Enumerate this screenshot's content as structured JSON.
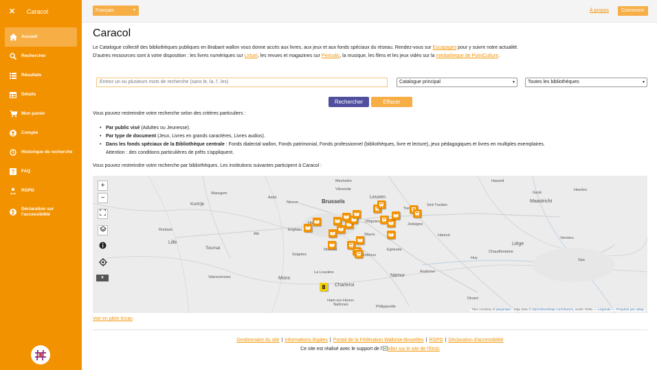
{
  "sidebar": {
    "title": "Caracol",
    "close_icon": "✕",
    "items": [
      {
        "label": "Accueil",
        "icon": "home-icon"
      },
      {
        "label": "Rechercher",
        "icon": "search-icon"
      },
      {
        "label": "Résultats",
        "icon": "list-icon"
      },
      {
        "label": "Détails",
        "icon": "details-icon"
      },
      {
        "label": "Mon panier",
        "icon": "cart-icon"
      },
      {
        "label": "Compte",
        "icon": "account-icon"
      },
      {
        "label": "Historique de recherche",
        "icon": "history-icon"
      },
      {
        "label": "FAQ",
        "icon": "faq-icon"
      },
      {
        "label": "RGPD",
        "icon": "rgpd-icon"
      },
      {
        "label": "Déclaration sur l'accessibilité",
        "icon": "accessibility-icon"
      }
    ],
    "active_index": 0
  },
  "topbar": {
    "language": "Français",
    "apropos": "À propos",
    "connexion": "Connexion"
  },
  "main": {
    "title": "Caracol",
    "intro": {
      "line1_a": "Le Catalogue collectif des bibliothèques publiques en Brabant wallon vous donne accès aux livres, aux jeux et aux fonds spéciaux du réseau. Rendez-vous sur ",
      "escapages": "Escapages",
      "line1_b": " pour y suivre notre actualité.",
      "line2_a": "D'autres ressources sont à votre disposition : les livres numériques sur ",
      "lirtuel": "Lirtuel",
      "line2_b": ", les revues et magazines sur ",
      "pericolic": "Pericolic",
      "line2_c": ", la musique, les films et les jeux vidéo sur la ",
      "pointculture": "médiathèque de PointCulture",
      "line2_d": "."
    },
    "search": {
      "placeholder": "Entrez un ou plusieurs mots de recherche (sans le, la, l', les)",
      "catalogue": "Catalogue principal",
      "libraries": "Toutes les bibliothèques",
      "search_button": "Rechercher",
      "clear_button": "Effacer"
    },
    "restrict_criteria": "Vous pouvez restreindre votre recherche selon des critères particuliers :",
    "criteria": [
      {
        "bold": "Par public visé",
        "text": " (Adultes ou Jeunesse)."
      },
      {
        "bold": "Par type de document",
        "text": " (Jeux, Livres en grands caractères, Livres audios)."
      },
      {
        "bold": "Dans les fonds spéciaux de la Bibliothèque centrale",
        "text": " : Fonds dialectal wallon, Fonds patrimonial, Fonds professionnel (bibliothèques, livre et lecture), jeux pédagogiques et livres en multiples exemplaires."
      }
    ],
    "criteria_note": "Attention : des conditions particulières de prêts s'appliquent.",
    "restrict_libraries": "Vous pouvez restreindre votre recherche par bibliothèques. Les institutions suivantes participent à Caracol :",
    "fullscreen_link": "Voir en plein écran"
  },
  "map": {
    "zoom_in": "+",
    "zoom_out": "−",
    "controls": [
      "fullscreen-icon",
      "layers-icon",
      "info-icon",
      "locate-icon"
    ],
    "places": {
      "brussels": "Brussels",
      "leuven": "Leuven",
      "maastricht": "Maastricht",
      "lille": "Lille",
      "namur": "Namur",
      "charleroi": "Charleroi",
      "kortrijk": "Kortrijk",
      "tournai": "Tournai",
      "mons": "Mons",
      "hasselt": "Hasselt",
      "wavre": "Wavre",
      "gembloux": "Gembloux",
      "nivelles": "Nivelles",
      "liege": "Liège",
      "tienen": "Tienen",
      "aalst": "Aalst",
      "ninove": "Ninove",
      "halle": "Halle",
      "soignies": "Soignies",
      "ath": "Ath",
      "enghien": "Enghien",
      "waregem": "Waregem",
      "roubaix": "Roubaix",
      "vilvoorde": "Vilvoorde",
      "mechelen": "Mechelen",
      "sint_truiden": "Sint-Truiden",
      "hannut": "Hannut",
      "huy": "Huy",
      "andenne": "Andenne",
      "dinant": "Dinant",
      "jodoigne": "Jodoigne",
      "ottignies": "Ottignies",
      "genk": "Genk",
      "heerlen": "Heerlen",
      "verviers": "Verviers",
      "spa": "Spa",
      "chaudfontaine": "Chaudfontaine",
      "valenciennes": "Valenciennes",
      "ham_sur_heure": "Ham-sur-Heure-Nalinnes",
      "eghezee": "Eghezée",
      "la_louviere": "La Louvière",
      "philippeville": "Philippeville"
    },
    "attribution_prefix": "Tiles courtesy of ",
    "jawg": "jawgmaps",
    "attribution_mid": " · Map data © ",
    "osm": "OpenStreetMap contributors",
    "attribution_suffix": ", under ODbL — ",
    "legende": "Légende",
    "propulse": " — Propulsé par uMap"
  },
  "footer": {
    "links": [
      "Gestionnaire du site",
      "Informations légales",
      "Portail de la Fédération Wallonie-Bruxelles",
      "RGPD",
      "Déclaration d'accessibilité"
    ],
    "support_text": "Ce site est réalisé avec le support de l'",
    "etnic_alt": "Aller sur le site de l'Etnic"
  },
  "colors": {
    "brand": "#f39200",
    "brand_light": "#f6ae45",
    "search_button": "#4f4f9e",
    "marker_highlight": "#f7d200"
  }
}
